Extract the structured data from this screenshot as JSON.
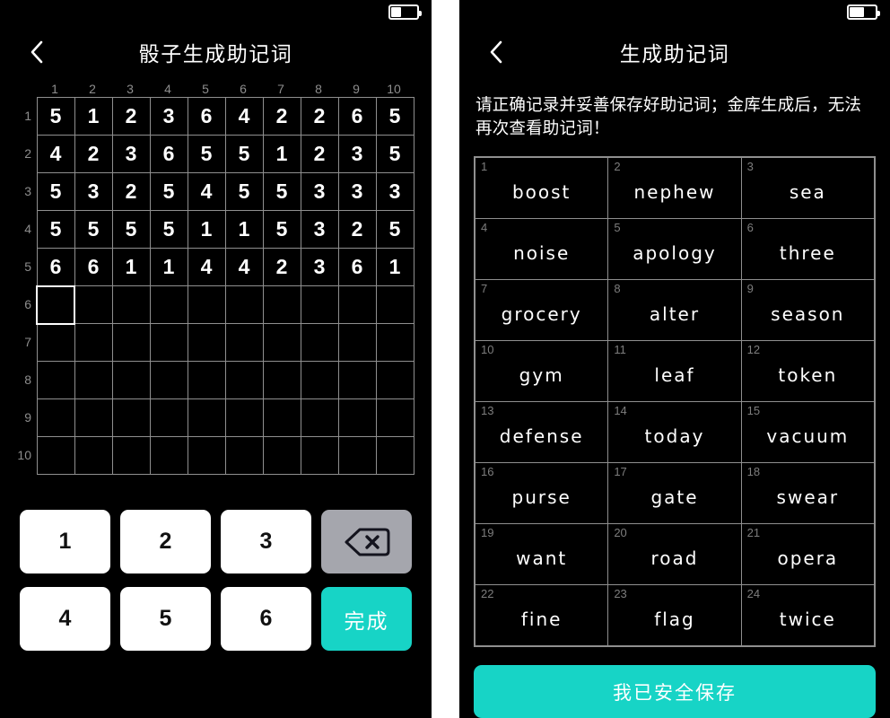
{
  "theme": {
    "background": "#000000",
    "accent": "#17d4c6",
    "grid_line": "#8f8f8f",
    "muted_text": "#8d8d8d",
    "key_back_bg": "#a5a6ad"
  },
  "left": {
    "status": {
      "battery_pct_label": "38%",
      "battery_level": 38
    },
    "nav": {
      "back_icon": "chevron-left-icon",
      "title": "骰子生成助记词"
    },
    "dice": {
      "col_headers": [
        "1",
        "2",
        "3",
        "4",
        "5",
        "6",
        "7",
        "8",
        "9",
        "10"
      ],
      "row_headers": [
        "1",
        "2",
        "3",
        "4",
        "5",
        "6",
        "7",
        "8",
        "9",
        "10"
      ],
      "rows": [
        [
          "5",
          "1",
          "2",
          "3",
          "6",
          "4",
          "2",
          "2",
          "6",
          "5"
        ],
        [
          "4",
          "2",
          "3",
          "6",
          "5",
          "5",
          "1",
          "2",
          "3",
          "5"
        ],
        [
          "5",
          "3",
          "2",
          "5",
          "4",
          "5",
          "5",
          "3",
          "3",
          "3"
        ],
        [
          "5",
          "5",
          "5",
          "5",
          "1",
          "1",
          "5",
          "3",
          "2",
          "5"
        ],
        [
          "6",
          "6",
          "1",
          "1",
          "4",
          "4",
          "2",
          "3",
          "6",
          "1"
        ],
        [
          "",
          "",
          "",
          "",
          "",
          "",
          "",
          "",
          "",
          ""
        ],
        [
          "",
          "",
          "",
          "",
          "",
          "",
          "",
          "",
          "",
          ""
        ],
        [
          "",
          "",
          "",
          "",
          "",
          "",
          "",
          "",
          "",
          ""
        ],
        [
          "",
          "",
          "",
          "",
          "",
          "",
          "",
          "",
          "",
          ""
        ],
        [
          "",
          "",
          "",
          "",
          "",
          "",
          "",
          "",
          "",
          ""
        ]
      ],
      "cursor": {
        "row": 6,
        "col": 1
      }
    },
    "keypad": {
      "keys": [
        {
          "label": "1",
          "type": "digit"
        },
        {
          "label": "2",
          "type": "digit"
        },
        {
          "label": "3",
          "type": "digit"
        },
        {
          "label": "",
          "type": "backspace",
          "icon": "backspace-icon"
        },
        {
          "label": "4",
          "type": "digit"
        },
        {
          "label": "5",
          "type": "digit"
        },
        {
          "label": "6",
          "type": "digit"
        },
        {
          "label": "完成",
          "type": "done"
        }
      ]
    }
  },
  "right": {
    "status": {
      "battery_pct_label": "52%",
      "battery_level": 52
    },
    "nav": {
      "back_icon": "chevron-left-icon",
      "title": "生成助记词"
    },
    "notice": "请正确记录并妥善保存好助记词；金库生成后，无法再次查看助记词！",
    "words": [
      {
        "index": "1",
        "word": "boost"
      },
      {
        "index": "2",
        "word": "nephew"
      },
      {
        "index": "3",
        "word": "sea"
      },
      {
        "index": "4",
        "word": "noise"
      },
      {
        "index": "5",
        "word": "apology"
      },
      {
        "index": "6",
        "word": "three"
      },
      {
        "index": "7",
        "word": "grocery"
      },
      {
        "index": "8",
        "word": "alter"
      },
      {
        "index": "9",
        "word": "season"
      },
      {
        "index": "10",
        "word": "gym"
      },
      {
        "index": "11",
        "word": "leaf"
      },
      {
        "index": "12",
        "word": "token"
      },
      {
        "index": "13",
        "word": "defense"
      },
      {
        "index": "14",
        "word": "today"
      },
      {
        "index": "15",
        "word": "vacuum"
      },
      {
        "index": "16",
        "word": "purse"
      },
      {
        "index": "17",
        "word": "gate"
      },
      {
        "index": "18",
        "word": "swear"
      },
      {
        "index": "19",
        "word": "want"
      },
      {
        "index": "20",
        "word": "road"
      },
      {
        "index": "21",
        "word": "opera"
      },
      {
        "index": "22",
        "word": "fine"
      },
      {
        "index": "23",
        "word": "flag"
      },
      {
        "index": "24",
        "word": "twice"
      }
    ],
    "save_button_label": "我已安全保存"
  }
}
